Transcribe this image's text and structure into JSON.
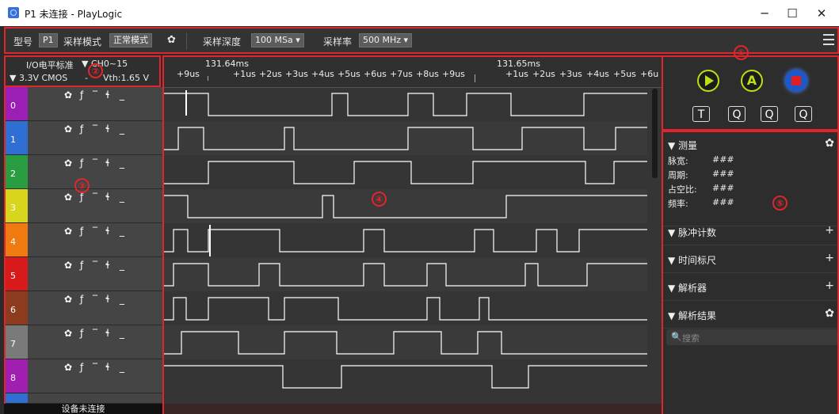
{
  "window": {
    "title": "P1 未连接 - PlayLogic",
    "minimize": "─",
    "maximize": "☐",
    "close": "✕"
  },
  "toolbar": {
    "model_label": "型号",
    "model_value": "P1",
    "sampling_mode_label": "采样模式",
    "sampling_mode_value": "正常模式",
    "sampling_depth_label": "采样深度",
    "sampling_depth_value": "100 MSa ▾",
    "sample_rate_label": "采样率",
    "sample_rate_value": "500 MHz ▾"
  },
  "io_panel": {
    "standard_label": "I/O电平标准",
    "channel_range": "▼ CH0~15",
    "voltage_standard": "▼ 3.3V CMOS",
    "vth": "Vth:1.65 V",
    "vth_prefix": "-"
  },
  "channels": [
    {
      "num": "0",
      "color": "#9c1fb5"
    },
    {
      "num": "1",
      "color": "#2f6fd4"
    },
    {
      "num": "2",
      "color": "#2a9c42"
    },
    {
      "num": "3",
      "color": "#d7d51c"
    },
    {
      "num": "4",
      "color": "#ef7b10"
    },
    {
      "num": "5",
      "color": "#d91a1a"
    },
    {
      "num": "6",
      "color": "#8d3b1e"
    },
    {
      "num": "7",
      "color": "#7a7a7a"
    },
    {
      "num": "8",
      "color": "#a01fb0"
    }
  ],
  "channel_icons": {
    "settings": "✿",
    "rising": "ƒ",
    "high": "‾",
    "falling": "ɬ",
    "low": "_"
  },
  "status": {
    "device_status": "设备未连接"
  },
  "timeline": {
    "timestamp_a": "131.64ms",
    "timestamp_b": "131.65ms",
    "ticks_a": [
      "+9us",
      "+1us",
      "+2us",
      "+3us",
      "+4us",
      "+5us",
      "+6us",
      "+7us",
      "+8us",
      "+9us"
    ],
    "ticks_b": [
      "+1us",
      "+2us",
      "+3us",
      "+4us",
      "+5us",
      "+6u"
    ]
  },
  "controls": {
    "run_icon": "play-icon",
    "auto_icon": "auto-icon",
    "auto_letter": "A",
    "stop_icon": "stop-icon"
  },
  "tools": {
    "text_tool": "T",
    "zoom_fit": "Q",
    "zoom_out": "Q",
    "zoom_in": "Q"
  },
  "right_panel": {
    "measure": {
      "title": "▼ 测量",
      "pulse_width_label": "脉宽:",
      "pulse_width_value": "###",
      "period_label": "周期:",
      "period_value": "###",
      "duty_label": "占空比:",
      "duty_value": "###",
      "freq_label": "频率:",
      "freq_value": "###",
      "settings_icon": "✿"
    },
    "pulse_count": {
      "title": "▼ 脉冲计数",
      "action": "+"
    },
    "time_ruler": {
      "title": "▼ 时间标尺",
      "action": "+"
    },
    "decoder": {
      "title": "▼ 解析器",
      "action": "+"
    },
    "decode_result": {
      "title": "▼ 解析结果",
      "action": "✿"
    },
    "search": {
      "icon": "🔍",
      "placeholder": "搜索"
    }
  },
  "callouts": [
    "①",
    "②",
    "③",
    "④",
    "⑤"
  ]
}
